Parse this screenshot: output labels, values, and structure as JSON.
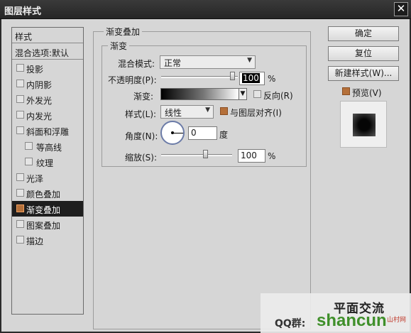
{
  "window": {
    "title": "图层样式",
    "close_icon": "✕"
  },
  "style_list": {
    "header": "样式",
    "blend_options": "混合选项:默认",
    "items": [
      {
        "label": "投影",
        "checked": false,
        "sub": false,
        "selected": false
      },
      {
        "label": "内阴影",
        "checked": false,
        "sub": false,
        "selected": false
      },
      {
        "label": "外发光",
        "checked": false,
        "sub": false,
        "selected": false
      },
      {
        "label": "内发光",
        "checked": false,
        "sub": false,
        "selected": false
      },
      {
        "label": "斜面和浮雕",
        "checked": false,
        "sub": false,
        "selected": false
      },
      {
        "label": "等高线",
        "checked": false,
        "sub": true,
        "selected": false
      },
      {
        "label": "纹理",
        "checked": false,
        "sub": true,
        "selected": false
      },
      {
        "label": "光泽",
        "checked": false,
        "sub": false,
        "selected": false
      },
      {
        "label": "颜色叠加",
        "checked": false,
        "sub": false,
        "selected": false
      },
      {
        "label": "渐变叠加",
        "checked": true,
        "sub": false,
        "selected": true
      },
      {
        "label": "图案叠加",
        "checked": false,
        "sub": false,
        "selected": false
      },
      {
        "label": "描边",
        "checked": false,
        "sub": false,
        "selected": false
      }
    ]
  },
  "gradient_overlay": {
    "section_title": "渐变叠加",
    "group_title": "渐变",
    "blend_mode_label": "混合模式:",
    "blend_mode_value": "正常",
    "opacity_label": "不透明度(P):",
    "opacity_value": "100",
    "opacity_unit": "%",
    "gradient_label": "渐变:",
    "reverse_label": "反向(R)",
    "reverse_checked": false,
    "style_label": "样式(L):",
    "style_value": "线性",
    "align_label": "与图层对齐(I)",
    "align_checked": true,
    "angle_label": "角度(N):",
    "angle_value": "0",
    "angle_unit": "度",
    "scale_label": "缩放(S):",
    "scale_value": "100",
    "scale_unit": "%"
  },
  "buttons": {
    "ok": "确定",
    "reset": "复位",
    "new_style": "新建样式(W)...",
    "preview_label": "预览(V)",
    "preview_checked": true
  },
  "watermark": {
    "line1": "平面交流",
    "qq": "QQ群:",
    "brand": "shancun",
    "brand_tag": "山村网"
  },
  "colors": {
    "accent_check": "#b5703a",
    "selected_row": "#1e1e1e",
    "dialog_bg": "#d6d6d6",
    "watermark_green": "#3f8f2a"
  }
}
